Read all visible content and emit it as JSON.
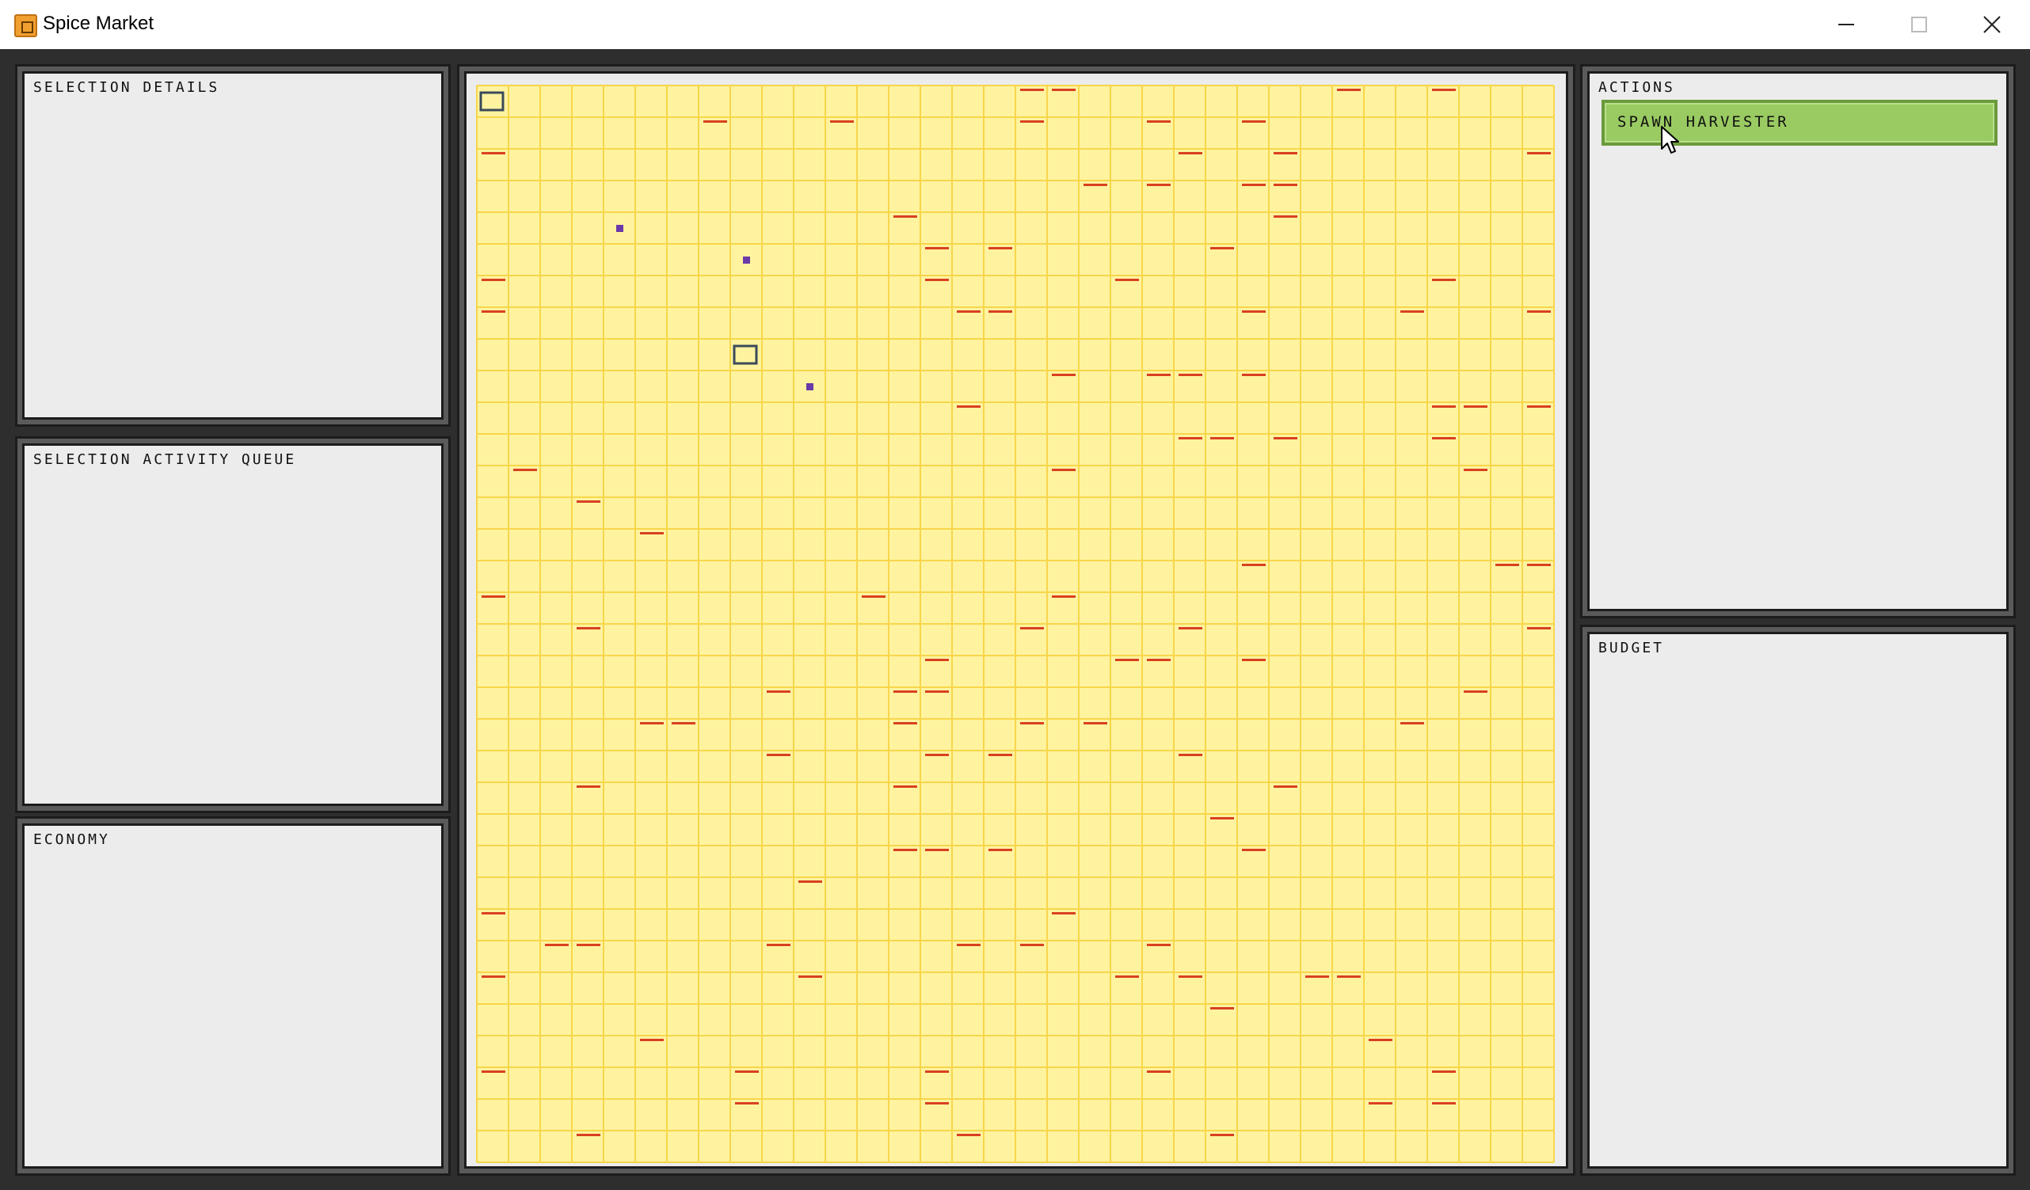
{
  "window": {
    "title": "Spice Market",
    "minimize_icon": "minimize-icon",
    "maximize_icon": "maximize-icon",
    "close_icon": "close-icon"
  },
  "panels": {
    "selection_details": {
      "title": "SELECTION DETAILS"
    },
    "activity_queue": {
      "title": "SELECTION ACTIVITY QUEUE"
    },
    "economy": {
      "title": "ECONOMY"
    },
    "actions": {
      "title": "ACTIONS",
      "spawn_button_label": "SPAWN HARVESTER"
    },
    "budget": {
      "title": "BUDGET"
    }
  },
  "map": {
    "columns": 34,
    "rows": 34,
    "colors": {
      "tile": "#fff3a0",
      "grid_line": "#f7d64a",
      "spice": "#d94020",
      "unit": "#6a3aa8",
      "building_outline": "#3a4a5a"
    },
    "spice_tiles": [
      [
        17,
        0
      ],
      [
        18,
        0
      ],
      [
        27,
        0
      ],
      [
        30,
        0
      ],
      [
        7,
        1
      ],
      [
        11,
        1
      ],
      [
        17,
        1
      ],
      [
        21,
        1
      ],
      [
        24,
        1
      ],
      [
        0,
        2
      ],
      [
        22,
        2
      ],
      [
        25,
        2
      ],
      [
        33,
        2
      ],
      [
        19,
        3
      ],
      [
        21,
        3
      ],
      [
        24,
        3
      ],
      [
        25,
        3
      ],
      [
        13,
        4
      ],
      [
        25,
        4
      ],
      [
        14,
        5
      ],
      [
        16,
        5
      ],
      [
        23,
        5
      ],
      [
        0,
        6
      ],
      [
        14,
        6
      ],
      [
        20,
        6
      ],
      [
        30,
        6
      ],
      [
        0,
        7
      ],
      [
        15,
        7
      ],
      [
        16,
        7
      ],
      [
        24,
        7
      ],
      [
        29,
        7
      ],
      [
        33,
        7
      ],
      [
        18,
        9
      ],
      [
        21,
        9
      ],
      [
        22,
        9
      ],
      [
        24,
        9
      ],
      [
        15,
        10
      ],
      [
        30,
        10
      ],
      [
        31,
        10
      ],
      [
        33,
        10
      ],
      [
        22,
        11
      ],
      [
        23,
        11
      ],
      [
        25,
        11
      ],
      [
        30,
        11
      ],
      [
        1,
        12
      ],
      [
        18,
        12
      ],
      [
        31,
        12
      ],
      [
        3,
        13
      ],
      [
        5,
        14
      ],
      [
        24,
        15
      ],
      [
        32,
        15
      ],
      [
        33,
        15
      ],
      [
        0,
        16
      ],
      [
        12,
        16
      ],
      [
        18,
        16
      ],
      [
        3,
        17
      ],
      [
        17,
        17
      ],
      [
        22,
        17
      ],
      [
        33,
        17
      ],
      [
        14,
        18
      ],
      [
        20,
        18
      ],
      [
        21,
        18
      ],
      [
        24,
        18
      ],
      [
        9,
        19
      ],
      [
        13,
        19
      ],
      [
        14,
        19
      ],
      [
        31,
        19
      ],
      [
        5,
        20
      ],
      [
        6,
        20
      ],
      [
        13,
        20
      ],
      [
        17,
        20
      ],
      [
        19,
        20
      ],
      [
        29,
        20
      ],
      [
        9,
        21
      ],
      [
        14,
        21
      ],
      [
        16,
        21
      ],
      [
        22,
        21
      ],
      [
        3,
        22
      ],
      [
        13,
        22
      ],
      [
        25,
        22
      ],
      [
        23,
        23
      ],
      [
        13,
        24
      ],
      [
        14,
        24
      ],
      [
        16,
        24
      ],
      [
        24,
        24
      ],
      [
        10,
        25
      ],
      [
        0,
        26
      ],
      [
        18,
        26
      ],
      [
        2,
        27
      ],
      [
        3,
        27
      ],
      [
        9,
        27
      ],
      [
        15,
        27
      ],
      [
        17,
        27
      ],
      [
        21,
        27
      ],
      [
        0,
        28
      ],
      [
        10,
        28
      ],
      [
        20,
        28
      ],
      [
        22,
        28
      ],
      [
        26,
        28
      ],
      [
        27,
        28
      ],
      [
        23,
        29
      ],
      [
        5,
        30
      ],
      [
        28,
        30
      ],
      [
        0,
        31
      ],
      [
        8,
        31
      ],
      [
        14,
        31
      ],
      [
        21,
        31
      ],
      [
        30,
        31
      ],
      [
        8,
        32
      ],
      [
        14,
        32
      ],
      [
        28,
        32
      ],
      [
        30,
        32
      ],
      [
        3,
        33
      ],
      [
        15,
        33
      ],
      [
        23,
        33
      ]
    ],
    "units": [
      [
        4,
        4
      ],
      [
        8,
        5
      ],
      [
        10,
        9
      ]
    ],
    "buildings": [
      [
        0,
        0
      ],
      [
        8,
        8
      ]
    ]
  }
}
